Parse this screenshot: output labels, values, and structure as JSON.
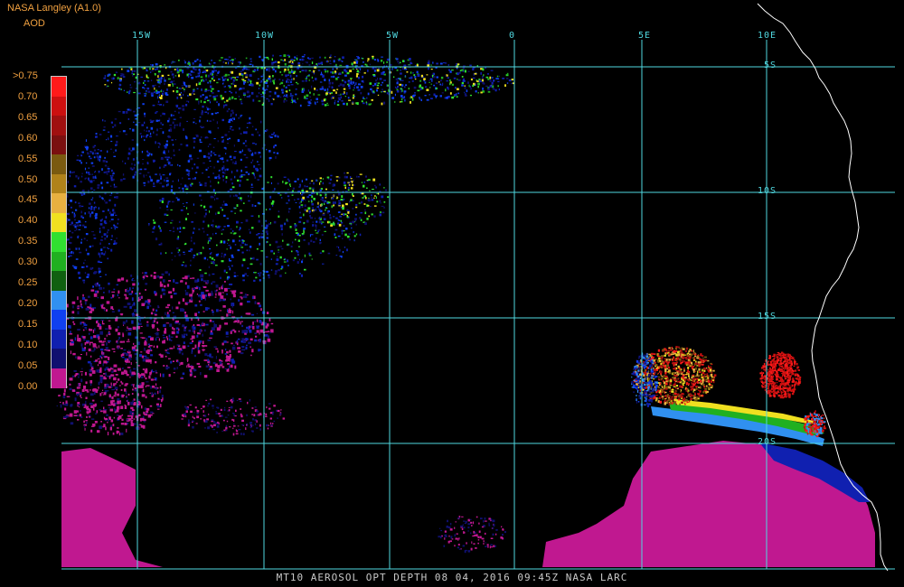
{
  "header": {
    "organization": "NASA Langley (A1.0)",
    "variable": "AOD"
  },
  "legend": {
    "ticks": [
      ">0.75",
      "0.70",
      "0.65",
      "0.60",
      "0.55",
      "0.50",
      "0.45",
      "0.40",
      "0.35",
      "0.30",
      "0.25",
      "0.20",
      "0.15",
      "0.10",
      "0.05",
      "0.00"
    ],
    "colors": [
      "#ff1a1a",
      "#cc1010",
      "#a01010",
      "#7a1010",
      "#7a5a10",
      "#b0821a",
      "#e8b040",
      "#f0e020",
      "#30e030",
      "#20b020",
      "#106010",
      "#3090f0",
      "#1040f0",
      "#1020b0",
      "#101070",
      "#c01890"
    ]
  },
  "grid": {
    "longitude_labels": [
      "15W",
      "10W",
      "5W",
      "0",
      "5E",
      "10E"
    ],
    "latitude_labels": [
      "5S",
      "10S",
      "15S",
      "20S"
    ]
  },
  "footer": {
    "text": "MT10  AEROSOL OPT DEPTH   08 04, 2016 09:45Z   NASA LARC"
  },
  "colors": {
    "background": "#000000",
    "grid_lines": "#50d8e0",
    "coastline": "#ffffff",
    "label_orange": "#f0a040",
    "footer_text": "#c8c8c8"
  }
}
